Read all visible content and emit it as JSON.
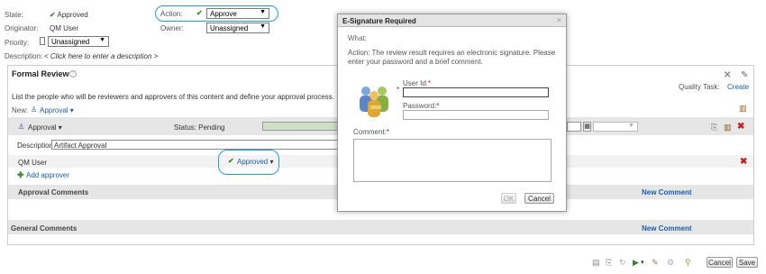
{
  "top": {
    "state_label": "State:",
    "state_value": "Approved",
    "action_label": "Action:",
    "action_value": "Approve",
    "originator_label": "Originator:",
    "originator_value": "QM User",
    "owner_label": "Owner:",
    "owner_value": "Unassigned",
    "priority_label": "Priority:",
    "priority_value": "Unassigned",
    "description_label": "Description:",
    "description_value": "< Click here to enter a description >"
  },
  "review": {
    "title": "Formal Review",
    "quality_task_label": "Quality Task:",
    "create_link": "Create",
    "intro": "List the people who will be reviewers and approvers of this content and define your approval process.",
    "new_label": "New:",
    "new_approval": "Approval",
    "approval_header": "Approval",
    "status": "Status: Pending",
    "description_label": "Description:",
    "description_value": "Artifact Approval",
    "approver_name": "QM User",
    "approver_status": "Approved",
    "add_approver": "Add approver",
    "approval_comments": "Approval Comments",
    "new_comment_1": "New Comment",
    "general_comments": "General Comments",
    "new_comment_2": "New Comment"
  },
  "footer": {
    "cancel": "Cancel",
    "save": "Save"
  },
  "dialog": {
    "title": "E-Signature Required",
    "what_label": "What:",
    "action_text": "Action: The review result requires an electronic signature. Please enter your password and a brief comment.",
    "userid_label": "User Id:",
    "password_label": "Password:",
    "comment_label": "Comment:",
    "req_mark": "*",
    "ok": "OK",
    "cancel": "Cancel"
  },
  "colors": {
    "accent_link": "#1a5ea8",
    "check_green": "#3a8a2a",
    "highlight_circle": "#1aa0d8",
    "delete_red": "#c02020"
  }
}
